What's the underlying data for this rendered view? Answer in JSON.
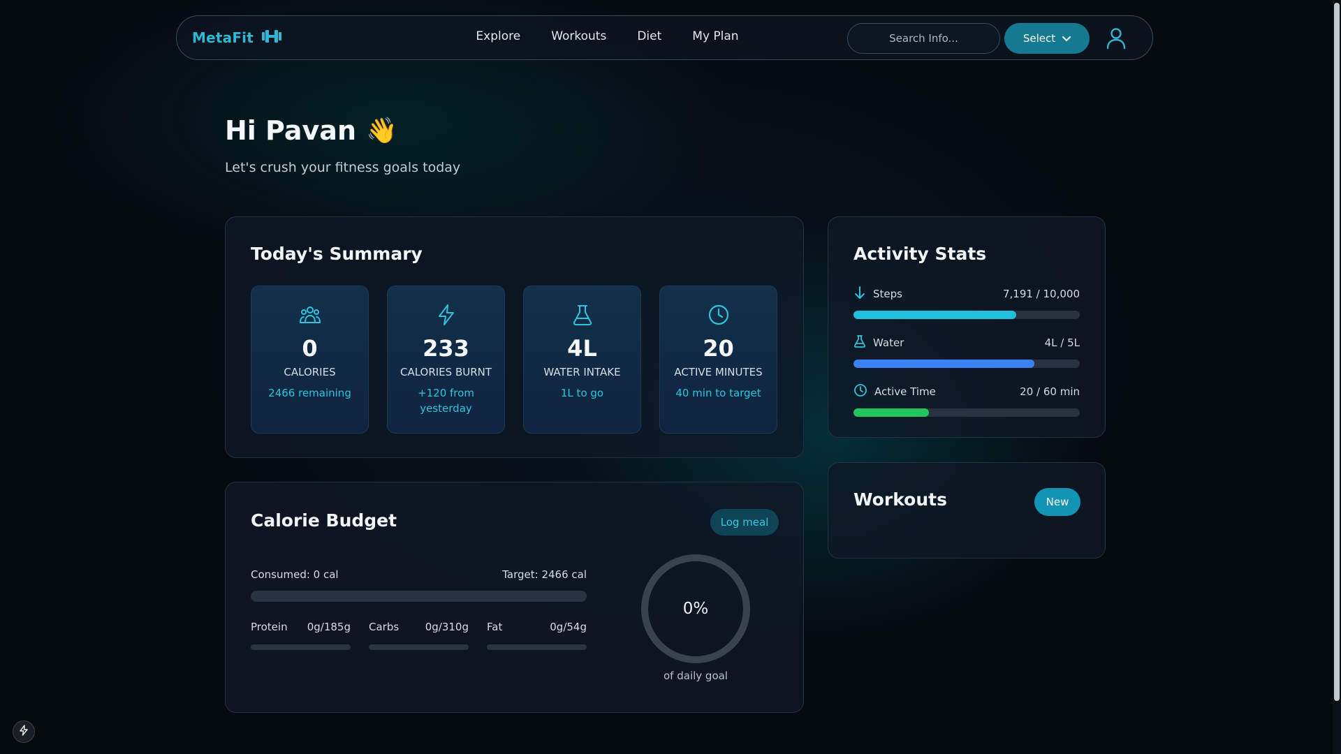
{
  "nav": {
    "brand": "MetaFit",
    "links": [
      "Explore",
      "Workouts",
      "Diet",
      "My Plan"
    ],
    "search_placeholder": "Search Info...",
    "select_label": "Select"
  },
  "header": {
    "greeting": "Hi Pavan",
    "wave": "👋",
    "subtitle": "Let's crush your fitness goals today"
  },
  "summary": {
    "title": "Today's Summary",
    "tiles": [
      {
        "icon": "users-icon",
        "value": "0",
        "label": "CALORIES",
        "sub": "2466 remaining"
      },
      {
        "icon": "lightning-icon",
        "value": "233",
        "label": "CALORIES BURNT",
        "sub": "+120 from yesterday"
      },
      {
        "icon": "flask-icon",
        "value": "4L",
        "label": "WATER INTAKE",
        "sub": "1L to go"
      },
      {
        "icon": "clock-icon",
        "value": "20",
        "label": "ACTIVE MINUTES",
        "sub": "40 min to target"
      }
    ]
  },
  "budget": {
    "title": "Calorie Budget",
    "log_label": "Log meal",
    "consumed": "Consumed: 0 cal",
    "target": "Target: 2466 cal",
    "consumed_fraction": 0,
    "macros": [
      {
        "name": "Protein",
        "value": "0g/185g",
        "fraction": 0
      },
      {
        "name": "Carbs",
        "value": "0g/310g",
        "fraction": 0
      },
      {
        "name": "Fat",
        "value": "0g/54g",
        "fraction": 0
      }
    ],
    "ring_percent": "0%",
    "ring_fraction": 0,
    "ring_caption": "of daily goal"
  },
  "activity": {
    "title": "Activity Stats",
    "stats": [
      {
        "name": "Steps",
        "value": "7,191 / 10,000",
        "fraction": 0.7191,
        "color": "#1ec0dc",
        "icon": "arrow-down-icon"
      },
      {
        "name": "Water",
        "value": "4L / 5L",
        "fraction": 0.8,
        "color": "#3b82f6",
        "icon": "flask-icon"
      },
      {
        "name": "Active Time",
        "value": "20 / 60 min",
        "fraction": 0.3333,
        "color": "#22c55e",
        "icon": "clock-icon"
      }
    ]
  },
  "workouts": {
    "title": "Workouts",
    "new_label": "New"
  },
  "colors": {
    "accent": "#2fb7d3",
    "tile_sub": "#2fc4dc",
    "select_bg": "#15798f",
    "new_bg": "#1494b4"
  }
}
